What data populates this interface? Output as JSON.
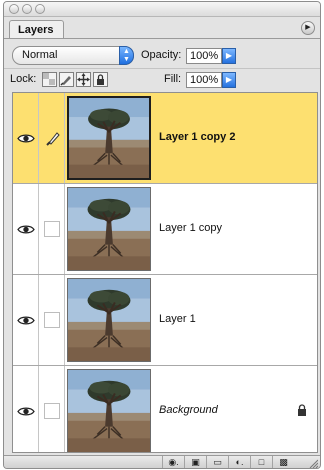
{
  "panel": {
    "tab_label": "Layers",
    "blend_mode": "Normal",
    "opacity_label": "Opacity:",
    "opacity_value": "100%",
    "lock_label": "Lock:",
    "fill_label": "Fill:",
    "fill_value": "100%"
  },
  "layers": [
    {
      "name": "Layer 1 copy 2",
      "selected": true,
      "visible": true,
      "locked": false
    },
    {
      "name": "Layer 1 copy",
      "selected": false,
      "visible": true,
      "locked": false
    },
    {
      "name": "Layer 1",
      "selected": false,
      "visible": true,
      "locked": false
    },
    {
      "name": "Background",
      "selected": false,
      "visible": true,
      "locked": true
    }
  ],
  "colors": {
    "selected_row": "#fde070",
    "accent_blue": "#2572df"
  },
  "icons": {
    "window_buttons": [
      "close-icon",
      "minimize-icon",
      "zoom-icon"
    ],
    "panel_menu": "panel-menu-icon",
    "lock_options": [
      "lock-transparency-icon",
      "lock-paint-icon",
      "lock-move-icon",
      "lock-all-icon"
    ],
    "bottom_bar": [
      "layer-style-icon",
      "layer-mask-icon",
      "new-group-icon",
      "adjustment-layer-icon",
      "new-layer-icon",
      "trash-icon"
    ]
  }
}
